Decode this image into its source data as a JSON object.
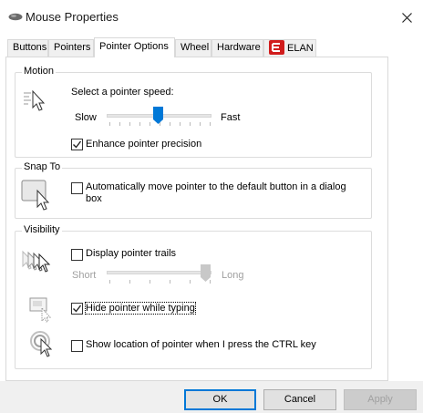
{
  "window": {
    "title": "Mouse Properties",
    "close_icon": "close-icon"
  },
  "tabs": [
    {
      "label": "Buttons",
      "active": false
    },
    {
      "label": "Pointers",
      "active": false
    },
    {
      "label": "Pointer Options",
      "active": true
    },
    {
      "label": "Wheel",
      "active": false
    },
    {
      "label": "Hardware",
      "active": false
    },
    {
      "label": "ELAN",
      "active": false,
      "icon": "elan-logo"
    }
  ],
  "motion": {
    "group_label": "Motion",
    "speed_label": "Select a pointer speed:",
    "slow_label": "Slow",
    "fast_label": "Fast",
    "speed_value": 6,
    "speed_max": 11,
    "enhance_label": "Enhance pointer precision",
    "enhance_checked": true,
    "icon": "pointer-speed-icon"
  },
  "snap_to": {
    "group_label": "Snap To",
    "label": "Automatically move pointer to the default button in a dialog box",
    "checked": false,
    "icon": "snap-to-icon"
  },
  "visibility": {
    "group_label": "Visibility",
    "trails_label": "Display pointer trails",
    "trails_checked": false,
    "short_label": "Short",
    "long_label": "Long",
    "trails_value": 1,
    "hide_label": "Hide pointer while typing",
    "hide_checked": true,
    "show_location_label": "Show location of pointer when I press the CTRL key",
    "show_location_checked": false,
    "trails_icon": "pointer-trails-icon",
    "hide_icon": "hide-pointer-icon",
    "location_icon": "pointer-location-icon"
  },
  "buttons": {
    "ok": "OK",
    "cancel": "Cancel",
    "apply": "Apply"
  },
  "colors": {
    "accent": "#0078d7",
    "disabled_text": "#a0a0a0",
    "thumb": "#0078d7"
  }
}
